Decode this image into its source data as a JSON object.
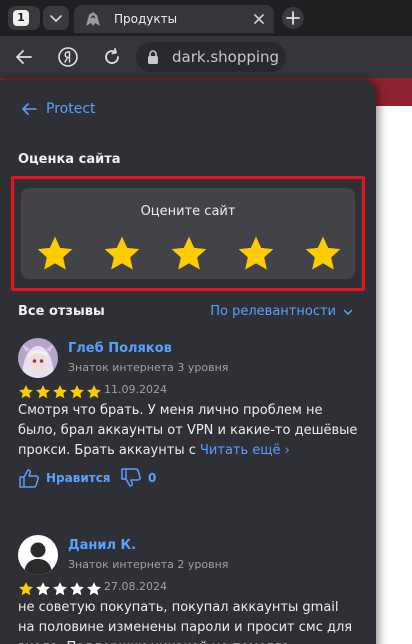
{
  "browser": {
    "tab_count": "1",
    "tab_title": "Продукты",
    "address": "dark.shopping"
  },
  "panel": {
    "back_label": "Protect",
    "rating_section_title": "Оценка сайта",
    "rating_prompt": "Оцените сайт",
    "rating_star_count": 5,
    "reviews_title": "Все отзывы",
    "sort_label": "По релевантности"
  },
  "reviews": [
    {
      "name": "Глеб Поляков",
      "level": "Знаток интернета 3 уровня",
      "rating": 5,
      "date": "11.09.2024",
      "text": "Смотря что брать. У меня лично проблем не было, брал аккаунты от VPN и какие-то дешёвые прокси. Брать аккаунты с",
      "read_more": "Читать ещё",
      "like_label": "Нравится",
      "dislike_count": "0"
    },
    {
      "name": "Данил К.",
      "level": "Знаток интернета 2 уровня",
      "rating": 1,
      "date": "27.08.2024",
      "text": "не советую покупать, покупал аккаунты gmail на половине изменены пароли и просит смс для входа. Поддержки никакой не помогла"
    }
  ],
  "colors": {
    "accent": "#5aa0ff",
    "star": "#ffcc00",
    "highlight": "#e8121c",
    "panel_bg": "#2f3035"
  }
}
